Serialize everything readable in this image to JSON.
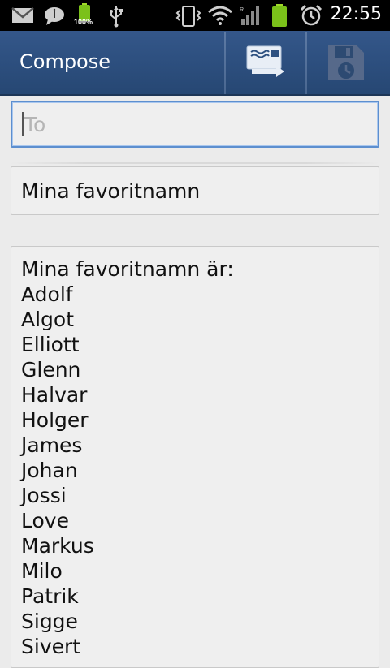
{
  "status_bar": {
    "battery_percent": "100%",
    "time": "22:55",
    "icons": [
      "gmail-icon",
      "chat-icon",
      "battery-icon",
      "usb-icon",
      "vibrate-icon",
      "wifi-icon",
      "signal-icon",
      "battery-icon",
      "alarm-icon"
    ]
  },
  "action_bar": {
    "title": "Compose",
    "buttons": [
      "send-icon",
      "save-draft-icon"
    ]
  },
  "compose": {
    "to_placeholder": "To",
    "subject": "Mina favoritnamn",
    "body": "Mina favoritnamn är:\nAdolf\nAlgot\nElliott\nGlenn\nHalvar\nHolger\nJames\nJohan\nJossi\nLove\nMarkus\nMilo\nPatrik\nSigge\nSivert"
  },
  "colors": {
    "action_bar": "#2d5080",
    "focus_border": "#5d8fcf",
    "background": "#ebebeb"
  }
}
